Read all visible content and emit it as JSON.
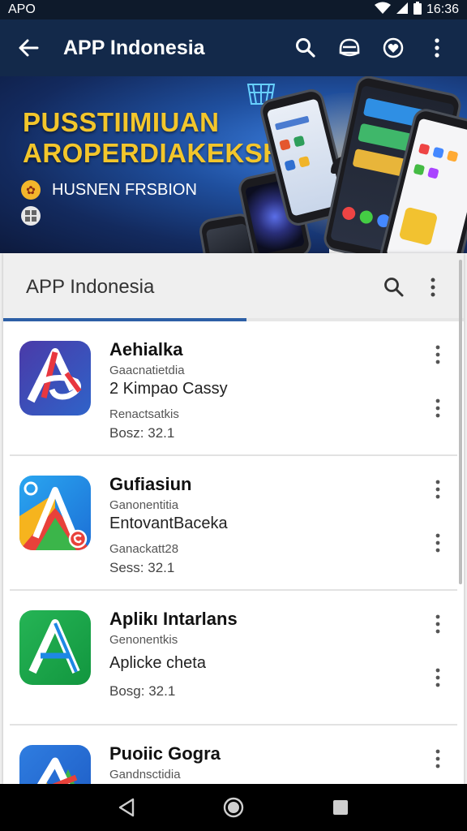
{
  "status_bar": {
    "left_text": "APO",
    "time": "16:36",
    "icons": [
      "wifi-icon",
      "signal-icon",
      "battery-icon"
    ]
  },
  "app_bar": {
    "title": "APP Indonesia",
    "icons": [
      "back-arrow-icon",
      "search-icon",
      "helmet-icon",
      "heart-icon",
      "more-vert-icon"
    ]
  },
  "banner": {
    "headline_line1": "PUSSTIIMIUAN",
    "headline_line2": "AROPERDIAKEKSH",
    "subtitle": "HUSNEN FRSBION",
    "colors": {
      "headline": "#f3c62b",
      "background": "#1f4f9e"
    }
  },
  "panel": {
    "title": "APP Indonesia",
    "icons": [
      "search-icon",
      "more-vert-icon"
    ]
  },
  "apps": [
    {
      "name": "Aehialka",
      "line1": "Gaacnatietdia",
      "line2": "2 Kimpao Cassy",
      "line3": "Renactsatkis",
      "rating": "Bosz: 32.1"
    },
    {
      "name": "Gufiasiun",
      "line1": "Ganonentitia",
      "line2": "EntovantBaceka",
      "line3": "Ganackatt28",
      "rating": "Sess: 32.1"
    },
    {
      "name": "Aplikı Intarlans",
      "line1": "Genonentkis",
      "line2": "Aplicke cheta",
      "line3": "",
      "rating": "Bosg: 32.1"
    },
    {
      "name": "Puoiic Gogra",
      "line1": "Gandnsctidia",
      "line2": "",
      "line3": "",
      "rating": ""
    }
  ],
  "nav_bar": {
    "icons": [
      "back-triangle-icon",
      "home-circle-icon",
      "recents-square-icon"
    ]
  },
  "accent": "#2d5fa6"
}
